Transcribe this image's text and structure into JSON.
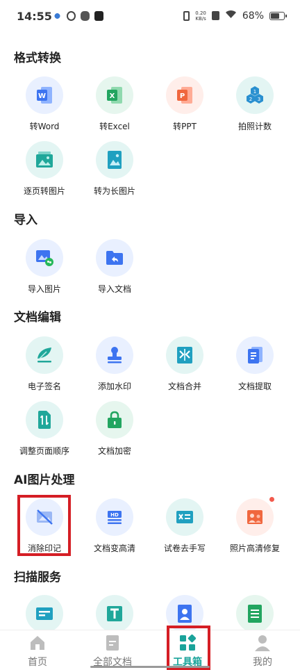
{
  "status_bar": {
    "time": "14:55",
    "netspeed_value": "0.20",
    "netspeed_unit": "KB/s",
    "battery": "68%",
    "battery_level": 0.68
  },
  "sections": {
    "format": {
      "title": "格式转换",
      "items": [
        {
          "label": "转Word",
          "icon": "word-icon"
        },
        {
          "label": "转Excel",
          "icon": "excel-icon"
        },
        {
          "label": "转PPT",
          "icon": "ppt-icon"
        },
        {
          "label": "拍照计数",
          "icon": "count-icon"
        },
        {
          "label": "逐页转图片",
          "icon": "pages-to-image-icon"
        },
        {
          "label": "转为长图片",
          "icon": "long-image-icon"
        }
      ]
    },
    "import": {
      "title": "导入",
      "items": [
        {
          "label": "导入图片",
          "icon": "import-image-icon"
        },
        {
          "label": "导入文档",
          "icon": "import-document-icon"
        }
      ]
    },
    "edit": {
      "title": "文档编辑",
      "items": [
        {
          "label": "电子签名",
          "icon": "signature-icon"
        },
        {
          "label": "添加水印",
          "icon": "watermark-icon"
        },
        {
          "label": "文档合并",
          "icon": "merge-icon"
        },
        {
          "label": "文档提取",
          "icon": "extract-icon"
        },
        {
          "label": "调整页面顺序",
          "icon": "reorder-icon"
        },
        {
          "label": "文档加密",
          "icon": "lock-icon"
        }
      ]
    },
    "ai": {
      "title": "AI图片处理",
      "items": [
        {
          "label": "消除印记",
          "icon": "erase-marks-icon"
        },
        {
          "label": "文档变高清",
          "icon": "hd-icon"
        },
        {
          "label": "试卷去手写",
          "icon": "remove-handwriting-icon"
        },
        {
          "label": "照片高清修复",
          "icon": "photo-restore-icon"
        }
      ]
    },
    "scan": {
      "title": "扫描服务",
      "items": [
        {
          "label": "",
          "icon": "id-card-icon"
        },
        {
          "label": "",
          "icon": "text-icon"
        },
        {
          "label": "",
          "icon": "portrait-icon"
        },
        {
          "label": "",
          "icon": "sheet-icon"
        }
      ]
    }
  },
  "tabbar": {
    "items": [
      {
        "label": "首页",
        "icon": "home-icon"
      },
      {
        "label": "全部文档",
        "icon": "documents-icon"
      },
      {
        "label": "工具箱",
        "icon": "toolbox-icon"
      },
      {
        "label": "我的",
        "icon": "profile-icon"
      }
    ],
    "active": "工具箱"
  },
  "colors": {
    "accent": "#1aa39a",
    "highlight_frame": "#d51e25",
    "badge": "#f25a4d"
  }
}
